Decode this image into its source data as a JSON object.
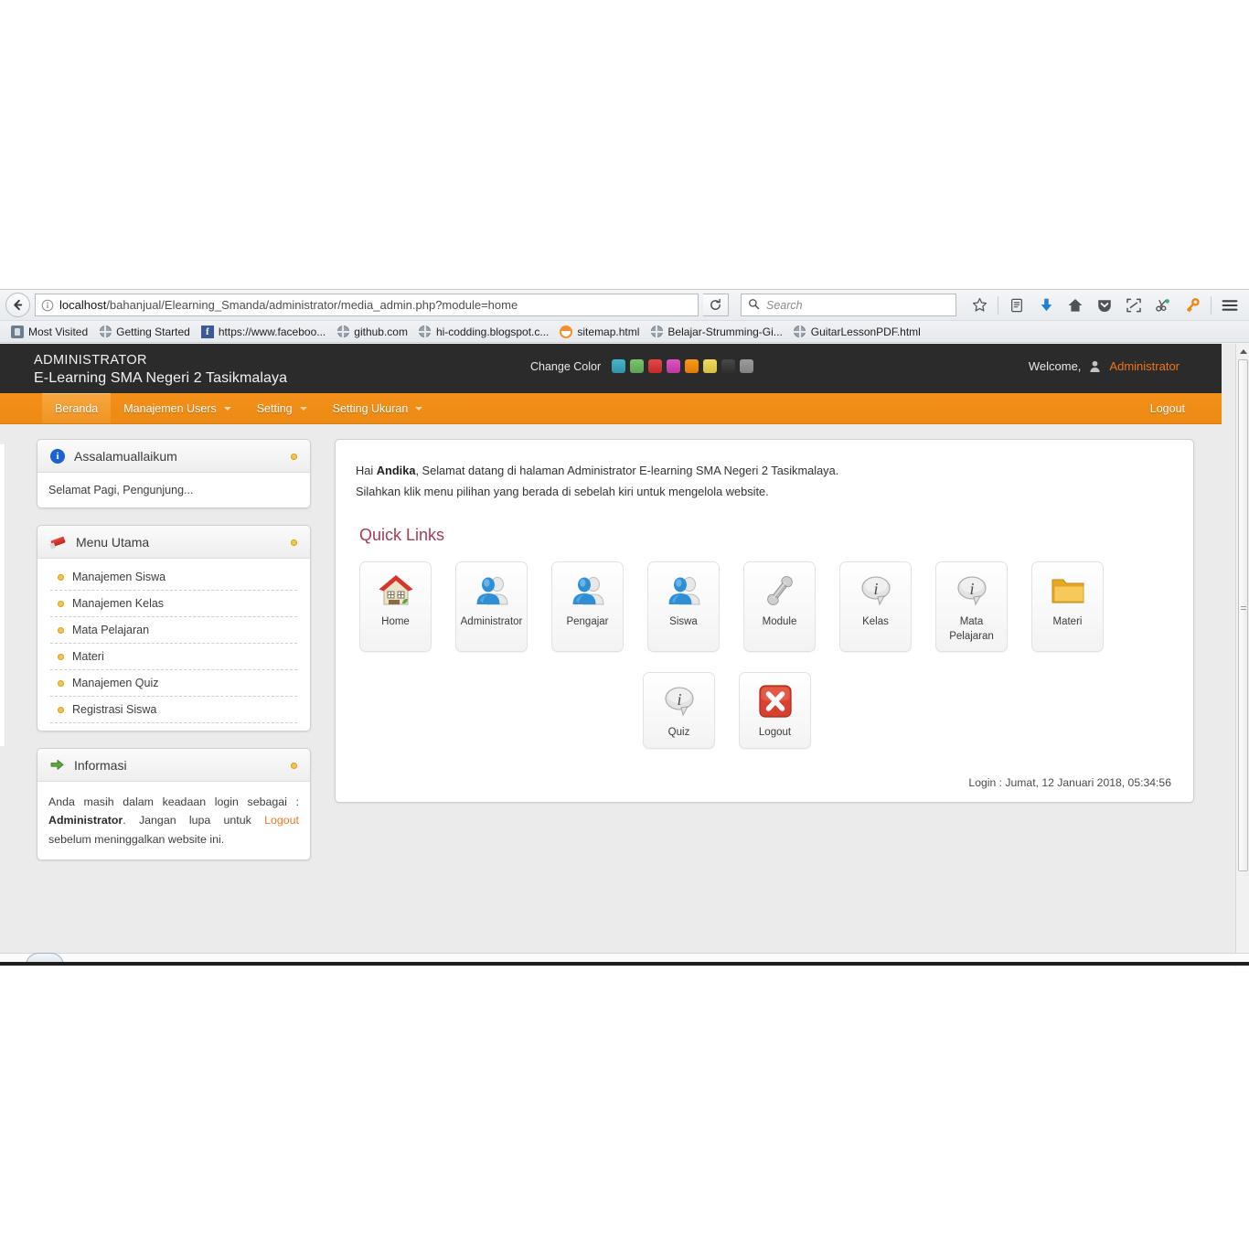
{
  "browser": {
    "back_icon": "back-arrow-icon",
    "url_identity_icon": "info-identity-icon",
    "url_host": "localhost",
    "url_path": "/bahanjual/Elearning_Smanda/administrator/media_admin.php?module=home",
    "reload_icon": "reload-icon",
    "search_placeholder": "Search",
    "search_value": "",
    "search_icon": "search-icon",
    "toolbar_icons": [
      {
        "name": "bookmark-star-icon",
        "glyph": "☆"
      },
      {
        "name": "library-icon",
        "glyph": "▤"
      },
      {
        "name": "downloads-icon",
        "glyph": "↓"
      },
      {
        "name": "home-icon",
        "glyph": "⌂"
      },
      {
        "name": "pocket-icon",
        "glyph": "▼"
      },
      {
        "name": "screenshot-icon",
        "glyph": "⌧"
      },
      {
        "name": "share-scissors-icon",
        "glyph": "✂"
      },
      {
        "name": "key-icon",
        "glyph": "⚷"
      },
      {
        "name": "hamburger-menu-icon",
        "glyph": "☰"
      }
    ],
    "bookmarks": [
      {
        "label": "Most Visited",
        "icon": "most-visited-icon"
      },
      {
        "label": "Getting Started",
        "icon": "globe-icon"
      },
      {
        "label": "https://www.faceboo...",
        "icon": "facebook-icon"
      },
      {
        "label": "github.com",
        "icon": "globe-icon"
      },
      {
        "label": "hi-codding.blogspot.c...",
        "icon": "globe-icon"
      },
      {
        "label": "sitemap.html",
        "icon": "orange-doc-icon"
      },
      {
        "label": "Belajar-Strumming-Gi...",
        "icon": "globe-icon"
      },
      {
        "label": "GuitarLessonPDF.html",
        "icon": "globe-icon"
      }
    ]
  },
  "site_header": {
    "brand_line1": "ADMINISTRATOR",
    "brand_line2": "E-Learning SMA Negeri 2 Tasikmalaya",
    "change_color_label": "Change Color",
    "swatches": [
      "#3aa6bd",
      "#6cb563",
      "#d93b38",
      "#d045b1",
      "#f08a0f",
      "#e6cc52",
      "#3a3a3a",
      "#8f8f8f"
    ],
    "welcome_label": "Welcome,",
    "user_icon": "user-icon",
    "user_name": "Administrator",
    "accent_orange": "#f0761a",
    "header_bg": "#2b2b2b"
  },
  "main_nav": {
    "items": [
      {
        "label": "Beranda",
        "has_caret": false,
        "active": true
      },
      {
        "label": "Manajemen Users",
        "has_caret": true,
        "active": false
      },
      {
        "label": "Setting",
        "has_caret": true,
        "active": false
      },
      {
        "label": "Setting Ukuran",
        "has_caret": true,
        "active": false
      }
    ],
    "logout_label": "Logout",
    "bar_color": "#f39019"
  },
  "sidebar": {
    "panels": [
      {
        "title": "Assalamuallaikum",
        "icon": "info-circle-icon",
        "dot_icon": "collapse-dot-icon",
        "body_text": "Selamat Pagi, Pengunjung..."
      },
      {
        "title": "Menu Utama",
        "icon": "pencil-icon",
        "dot_icon": "collapse-dot-icon",
        "items": [
          "Manajemen Siswa",
          "Manajemen Kelas",
          "Mata Pelajaran",
          "Materi",
          "Manajemen Quiz",
          "Registrasi Siswa"
        ]
      },
      {
        "title": "Informasi",
        "icon": "green-arrow-icon",
        "dot_icon": "collapse-dot-icon",
        "info_part1": "Anda masih dalam keadaan login sebagai :",
        "info_bold": "Administrator",
        "info_part2": ".",
        "info_part3": "Jangan lupa untuk",
        "info_link": "Logout",
        "info_part4": "sebelum meninggalkan website ini."
      }
    ]
  },
  "main": {
    "greet_prefix": "Hai",
    "greet_name": "Andika",
    "greet_suffix": ", Selamat datang di halaman Administrator E-learning SMA Negeri 2 Tasikmalaya.",
    "greet_line2": "Silahkan klik menu pilihan yang berada di sebelah kiri untuk mengelola website.",
    "quick_links_title": "Quick Links",
    "tiles_row1": [
      {
        "label": "Home",
        "icon": "house-icon"
      },
      {
        "label": "Administrator",
        "icon": "users-icon"
      },
      {
        "label": "Pengajar",
        "icon": "users-icon"
      },
      {
        "label": "Siswa",
        "icon": "users-icon"
      },
      {
        "label": "Module",
        "icon": "wrench-icon"
      },
      {
        "label": "Kelas",
        "icon": "info-bubble-icon"
      },
      {
        "label": "Mata Pelajaran",
        "icon": "info-bubble-icon"
      },
      {
        "label": "Materi",
        "icon": "folder-icon"
      }
    ],
    "tiles_row2": [
      {
        "label": "Quiz",
        "icon": "info-bubble-icon"
      },
      {
        "label": "Logout",
        "icon": "red-x-icon"
      }
    ],
    "login_timestamp": "Login : Jumat, 12 Januari 2018, 05:34:56",
    "quick_links_color": "#a43b52"
  }
}
